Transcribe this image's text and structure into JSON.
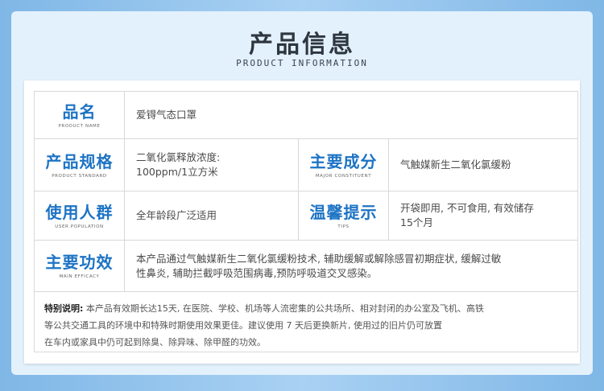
{
  "header": {
    "title_cn": "产品信息",
    "title_en": "PRODUCT INFORMATION"
  },
  "rows": {
    "name": {
      "label_cn": "品名",
      "label_en": "PRODUCT NAME",
      "value": "爱锝气态口罩"
    },
    "standard": {
      "label_cn": "产品规格",
      "label_en": "PRODUCT STANDARD",
      "value_line1": "二氧化氯释放浓度:",
      "value_line2": "100ppm/1立方米"
    },
    "constituent": {
      "label_cn": "主要成分",
      "label_en": "MAJOR CONSTITUENT",
      "value": "气触媒新生二氧化氯缓粉"
    },
    "population": {
      "label_cn": "使用人群",
      "label_en": "USER POPULATION",
      "value": "全年龄段广泛适用"
    },
    "tips": {
      "label_cn": "温馨提示",
      "label_en": "TIPS",
      "value_line1": "开袋即用, 不可食用, 有效储存",
      "value_line2": "15个月"
    },
    "efficacy": {
      "label_cn": "主要功效",
      "label_en": "MAIN EFFICACY",
      "value_line1": "本产品通过气触媒新生二氧化氯缓粉技术, 辅助缓解或解除感冒初期症状, 缓解过敏",
      "value_line2": "性鼻炎, 辅助拦截呼吸范围病毒,预防呼吸道交叉感染。"
    }
  },
  "note": {
    "label": "特别说明:",
    "line1": "本产品有效期长达15天, 在医院、学校、机场等人流密集的公共场所、相对封闭的办公室及飞机、高铁",
    "line2": "等公共交通工具的环境中和特殊时期使用效果更佳。建议使用 7 天后更换新片, 使用过的旧片仍可放置",
    "line3": "在车内或家具中仍可起到除臭、除异味、除甲醛的功效。"
  }
}
